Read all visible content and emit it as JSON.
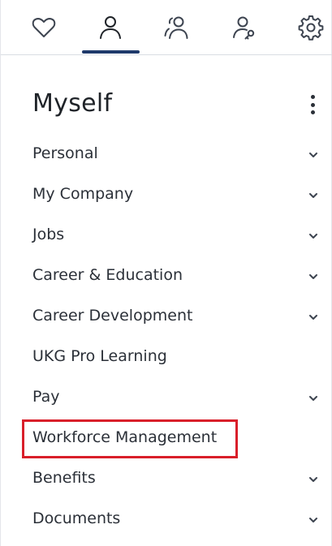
{
  "tabs": [
    {
      "id": "favorites",
      "icon": "heart-icon"
    },
    {
      "id": "myself",
      "icon": "person-icon",
      "active": true
    },
    {
      "id": "team",
      "icon": "people-icon"
    },
    {
      "id": "manager",
      "icon": "person-key-icon"
    },
    {
      "id": "settings",
      "icon": "gear-icon"
    }
  ],
  "header": {
    "title": "Myself",
    "more_icon": "more-vertical-icon"
  },
  "menu": {
    "items": [
      {
        "label": "Personal",
        "expandable": true
      },
      {
        "label": "My Company",
        "expandable": true
      },
      {
        "label": "Jobs",
        "expandable": true
      },
      {
        "label": "Career & Education",
        "expandable": true
      },
      {
        "label": "Career Development",
        "expandable": true
      },
      {
        "label": "UKG Pro Learning",
        "expandable": false
      },
      {
        "label": "Pay",
        "expandable": true
      },
      {
        "label": "Workforce Management",
        "expandable": false,
        "highlighted": true
      },
      {
        "label": "Benefits",
        "expandable": true
      },
      {
        "label": "Documents",
        "expandable": true
      }
    ]
  },
  "colors": {
    "accent_underline": "#1f3a6b",
    "highlight_border": "#d91f2a",
    "text": "#2b3038"
  }
}
